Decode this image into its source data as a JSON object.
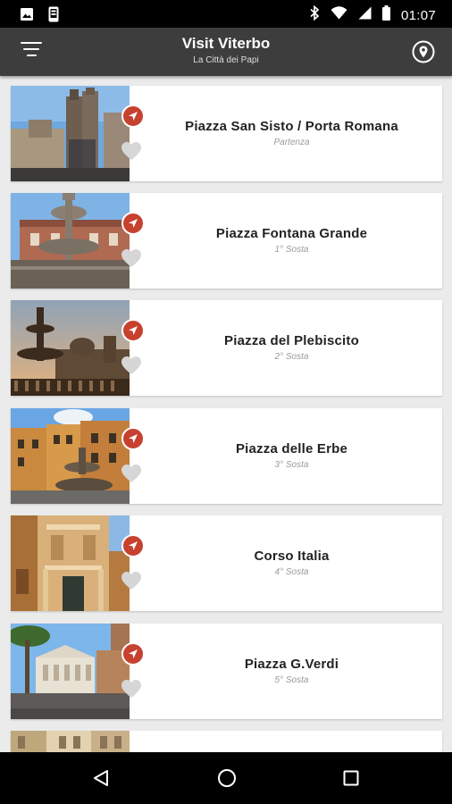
{
  "status_bar": {
    "time": "01:07",
    "icons": [
      "image-icon",
      "phone-notification-icon",
      "bluetooth-icon",
      "wifi-icon",
      "signal-icon",
      "battery-icon"
    ]
  },
  "app_bar": {
    "title": "Visit Viterbo",
    "subtitle": "La Città dei Papi",
    "menu_icon": "filter-menu-icon",
    "map_icon": "map-pin-icon"
  },
  "colors": {
    "app_bar": "#3d3d3d",
    "accent": "#c7412f",
    "background": "#ebebeb",
    "card": "#ffffff",
    "favorite_icon": "#d6d6d6"
  },
  "stops": [
    {
      "title": "Piazza San Sisto / Porta Romana",
      "subtitle": "Partenza"
    },
    {
      "title": "Piazza Fontana Grande",
      "subtitle": "1° Sosta"
    },
    {
      "title": "Piazza del Plebiscito",
      "subtitle": "2° Sosta"
    },
    {
      "title": "Piazza delle Erbe",
      "subtitle": "3° Sosta"
    },
    {
      "title": "Corso Italia",
      "subtitle": "4° Sosta"
    },
    {
      "title": "Piazza G.Verdi",
      "subtitle": "5° Sosta"
    },
    {
      "title": "",
      "subtitle": ""
    }
  ],
  "system_nav": {
    "back_icon": "back-triangle-icon",
    "home_icon": "home-circle-icon",
    "recents_icon": "recents-square-icon"
  }
}
